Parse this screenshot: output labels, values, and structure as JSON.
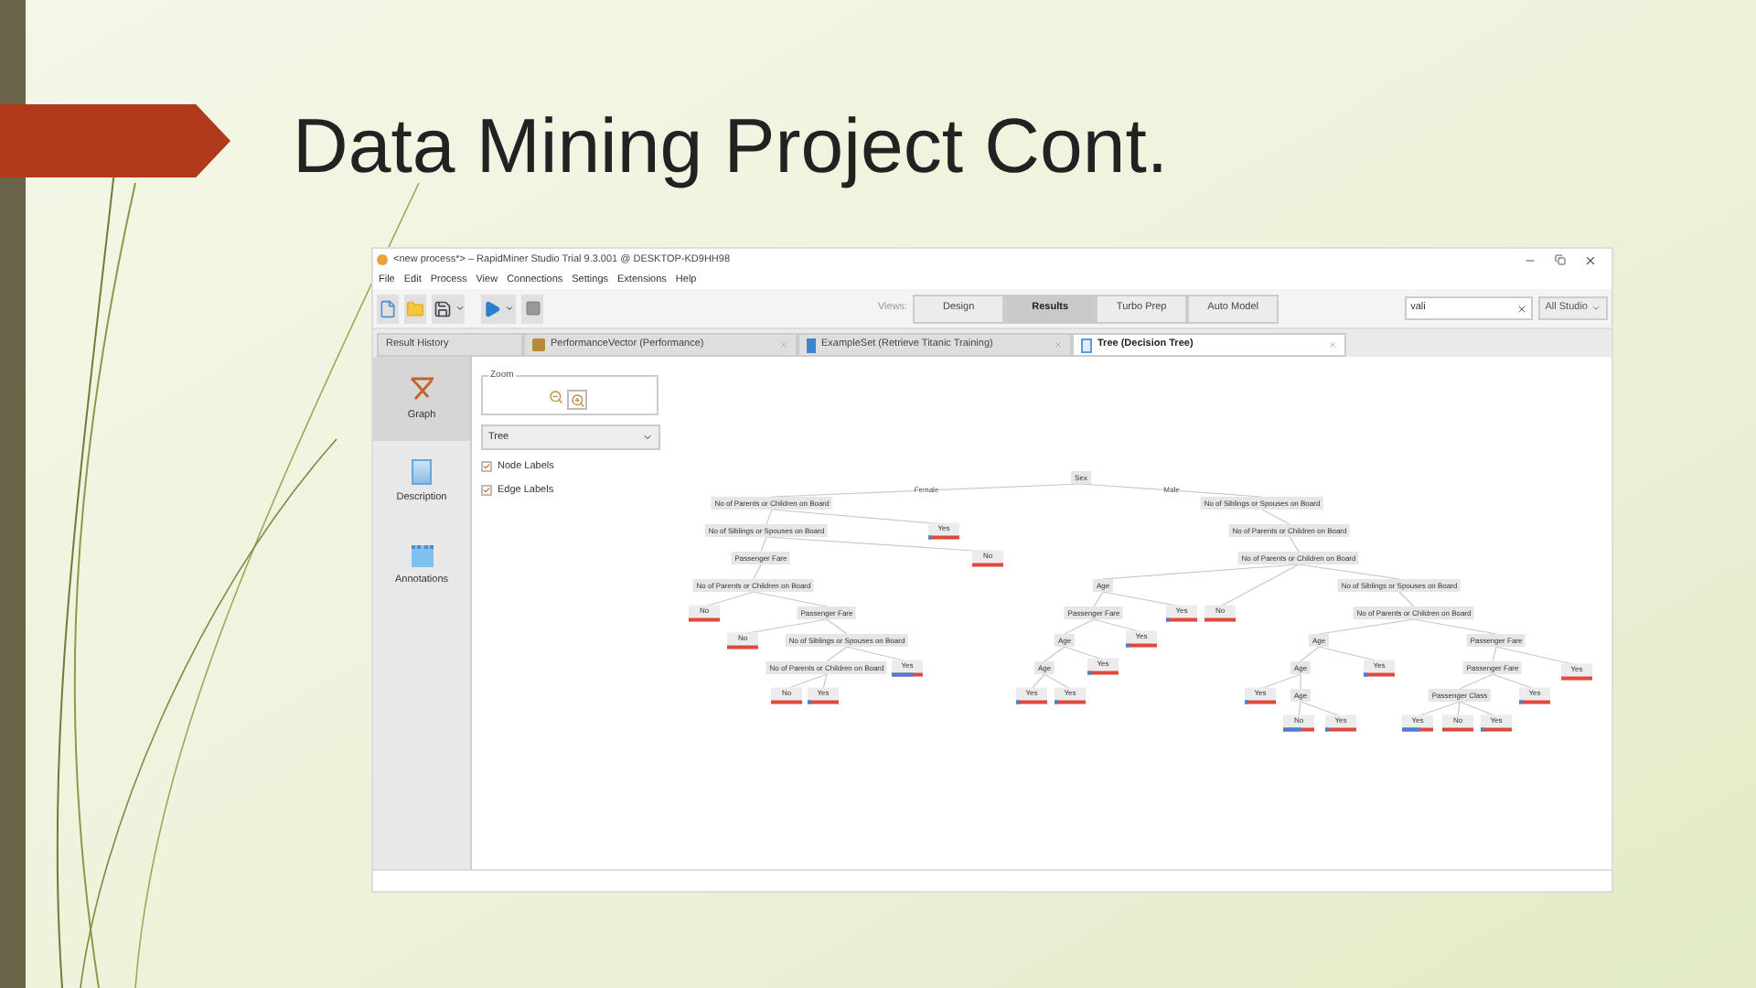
{
  "slide": {
    "title": "Data Mining Project Cont."
  },
  "window": {
    "title": "<new process*> – RapidMiner Studio Trial 9.3.001 @ DESKTOP-KD9HH98"
  },
  "menu": [
    "File",
    "Edit",
    "Process",
    "View",
    "Connections",
    "Settings",
    "Extensions",
    "Help"
  ],
  "views": {
    "label": "Views:",
    "tabs": [
      {
        "label": "Design",
        "selected": false
      },
      {
        "label": "Results",
        "selected": true
      },
      {
        "label": "Turbo Prep",
        "selected": false
      },
      {
        "label": "Auto Model",
        "selected": false
      }
    ]
  },
  "search": {
    "value": "vali"
  },
  "studio_dropdown": "All Studio",
  "result_tabs": [
    {
      "label": "Result History",
      "kind": "history",
      "selected": false
    },
    {
      "label": "PerformanceVector (Performance)",
      "kind": "performance",
      "selected": false
    },
    {
      "label": "ExampleSet (Retrieve Titanic Training)",
      "kind": "exampleset",
      "selected": false
    },
    {
      "label": "Tree (Decision Tree)",
      "kind": "tree",
      "selected": true
    }
  ],
  "side_tabs": [
    {
      "label": "Graph",
      "kind": "graph",
      "selected": true
    },
    {
      "label": "Description",
      "kind": "description",
      "selected": false
    },
    {
      "label": "Annotations",
      "kind": "annotations",
      "selected": false
    }
  ],
  "zoom": {
    "label": "Zoom"
  },
  "view_select": {
    "value": "Tree"
  },
  "options": [
    {
      "label": "Node Labels",
      "checked": true
    },
    {
      "label": "Edge Labels",
      "checked": true
    }
  ],
  "tree": {
    "label": "Sex",
    "kind": "split",
    "children": [
      {
        "edge": "Female",
        "label": "No of Parents or Children on Board",
        "kind": "split",
        "children": [
          {
            "label": "No of Siblings or Spouses on Board",
            "kind": "split",
            "children": [
              {
                "label": "Passenger Fare",
                "kind": "split",
                "children": [
                  {
                    "label": "No of Parents or Children on Board",
                    "kind": "split",
                    "children": [
                      {
                        "label": "No",
                        "kind": "leaf",
                        "level": 0
                      },
                      {
                        "label": "Passenger Fare",
                        "kind": "split",
                        "children": [
                          {
                            "label": "No",
                            "kind": "leaf",
                            "level": 0
                          },
                          {
                            "label": "No of Siblings or Spouses on Board",
                            "kind": "split",
                            "children": [
                              {
                                "label": "No of Parents or Children on Board",
                                "kind": "split",
                                "children": [
                                  {
                                    "label": "No",
                                    "kind": "leaf",
                                    "level": 0
                                  },
                                  {
                                    "label": "Yes",
                                    "kind": "leaf",
                                    "level": 0.1
                                  }
                                ]
                              },
                              {
                                "label": "Yes",
                                "kind": "leaf",
                                "level": 0.7
                              }
                            ]
                          }
                        ]
                      }
                    ]
                  }
                ]
              },
              {
                "label": "No",
                "kind": "leaf",
                "level": 0
              }
            ]
          },
          {
            "label": "Yes",
            "kind": "leaf",
            "level": 0.1
          }
        ]
      },
      {
        "edge": "Male",
        "label": "No of Siblings or Spouses on Board",
        "kind": "split",
        "children": [
          {
            "label": "No of Parents or Children on Board",
            "kind": "split",
            "children": [
              {
                "label": "No of Parents or Children on Board",
                "kind": "split",
                "children": [
                  {
                    "label": "Age",
                    "kind": "split",
                    "children": [
                      {
                        "label": "Passenger Fare",
                        "kind": "split",
                        "children": [
                          {
                            "label": "Age",
                            "kind": "split",
                            "children": [
                              {
                                "label": "Age",
                                "kind": "split",
                                "children": [
                                  {
                                    "label": "Yes",
                                    "kind": "leaf",
                                    "level": 0.1
                                  },
                                  {
                                    "label": "Yes",
                                    "kind": "leaf",
                                    "level": 0.1
                                  }
                                ]
                              },
                              {
                                "label": "Yes",
                                "kind": "leaf",
                                "level": 0.1
                              }
                            ]
                          },
                          {
                            "label": "Yes",
                            "kind": "leaf",
                            "level": 0.1
                          }
                        ]
                      },
                      {
                        "label": "Yes",
                        "kind": "leaf",
                        "level": 0.1
                      }
                    ]
                  },
                  {
                    "label": "No",
                    "kind": "leaf",
                    "level": 0
                  },
                  {
                    "label": "No of Siblings or Spouses on Board",
                    "kind": "split",
                    "children": [
                      {
                        "label": "No of Parents or Children on Board",
                        "kind": "split",
                        "children": [
                          {
                            "label": "Age",
                            "kind": "split",
                            "children": [
                              {
                                "label": "Age",
                                "kind": "split",
                                "children": [
                                  {
                                    "label": "Yes",
                                    "kind": "leaf",
                                    "level": 0.1
                                  },
                                  {
                                    "label": "Age",
                                    "kind": "split",
                                    "children": [
                                      {
                                        "label": "No",
                                        "kind": "leaf",
                                        "level": 0.6
                                      },
                                      {
                                        "label": "Yes",
                                        "kind": "leaf",
                                        "level": 0.1
                                      }
                                    ]
                                  }
                                ]
                              },
                              {
                                "label": "Yes",
                                "kind": "leaf",
                                "level": 0.1
                              }
                            ]
                          },
                          {
                            "label": "Passenger Fare",
                            "kind": "split",
                            "children": [
                              {
                                "label": "Passenger Fare",
                                "kind": "split",
                                "children": [
                                  {
                                    "label": "Passenger Class",
                                    "kind": "split",
                                    "children": [
                                      {
                                        "label": "Yes",
                                        "kind": "leaf",
                                        "level": 0.6
                                      },
                                      {
                                        "label": "No",
                                        "kind": "leaf",
                                        "level": 0
                                      },
                                      {
                                        "label": "Yes",
                                        "kind": "leaf",
                                        "level": 0.1
                                      }
                                    ]
                                  },
                                  {
                                    "label": "Yes",
                                    "kind": "leaf",
                                    "level": 0.1
                                  }
                                ]
                              },
                              {
                                "label": "Yes",
                                "kind": "leaf",
                                "level": 0
                              }
                            ]
                          }
                        ]
                      }
                    ]
                  }
                ]
              }
            ]
          }
        ]
      }
    ]
  }
}
